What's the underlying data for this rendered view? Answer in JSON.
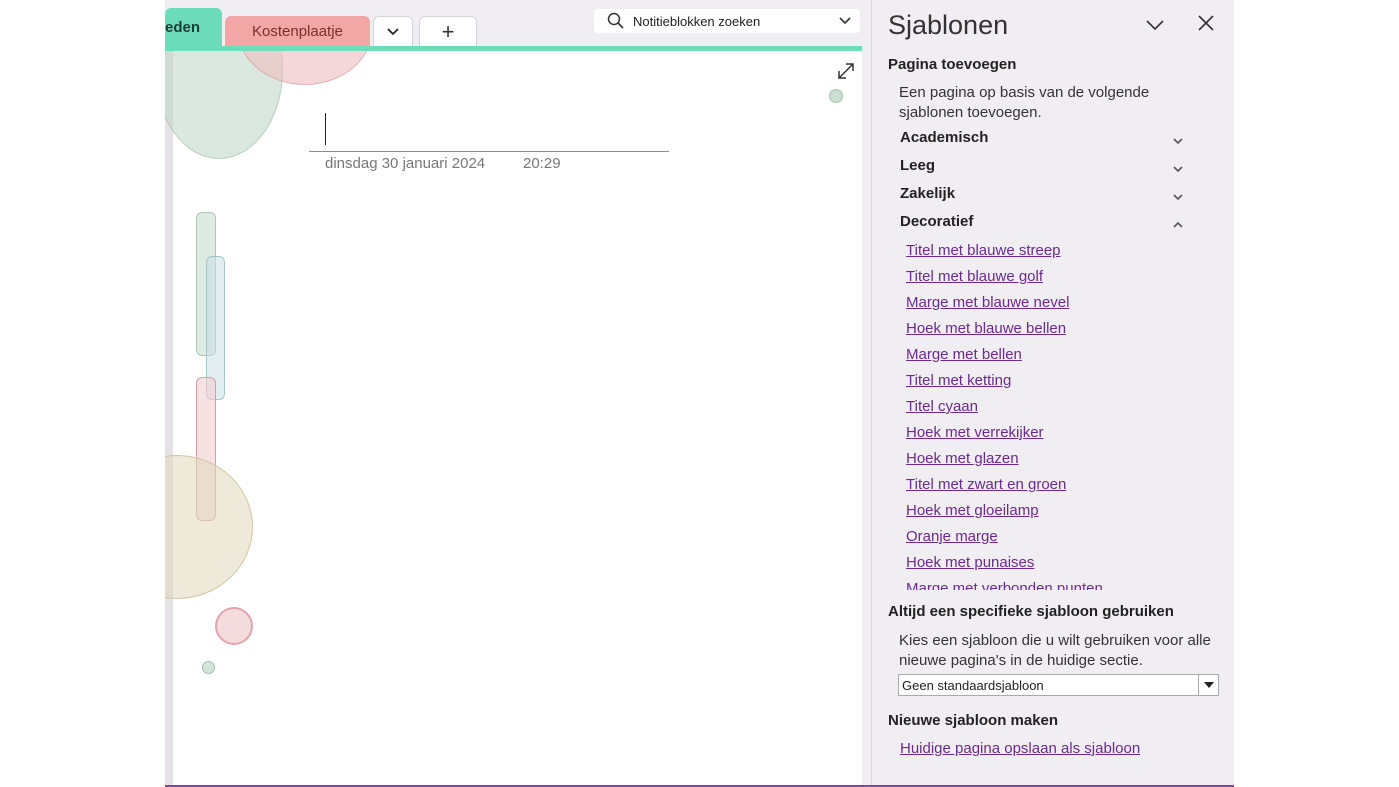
{
  "tabs": {
    "active_label": "eden",
    "second_label": "Kostenplaatje",
    "add_label": "+"
  },
  "search": {
    "placeholder": "Notitieblokken zoeken"
  },
  "page": {
    "date": "dinsdag 30 januari 2024",
    "time": "20:29"
  },
  "panel": {
    "title": "Sjablonen",
    "add_page_heading": "Pagina toevoegen",
    "add_page_desc": "Een pagina op basis van de volgende sjablonen toevoegen.",
    "categories": [
      "Academisch",
      "Leeg",
      "Zakelijk",
      "Decoratief"
    ],
    "decorative_templates": [
      "Titel met blauwe streep",
      "Titel met blauwe golf",
      "Marge met blauwe nevel",
      "Hoek met blauwe bellen",
      "Marge met bellen",
      "Titel met ketting",
      "Titel cyaan",
      "Hoek met verrekijker",
      "Hoek met glazen",
      "Titel met zwart en groen",
      "Hoek met gloeilamp",
      "Oranje marge",
      "Hoek met punaises",
      "Marge met verbonden punten"
    ],
    "always_heading": "Altijd een specifieke sjabloon gebruiken",
    "always_desc": "Kies een sjabloon die u wilt gebruiken voor alle nieuwe pagina's in de huidige sectie.",
    "default_template": "Geen standaardsjabloon",
    "new_heading": "Nieuwe sjabloon maken",
    "save_link": "Huidige pagina opslaan als sjabloon"
  },
  "colors": {
    "tab_active": "#6ddcba",
    "tab_second": "#f3a6a6",
    "link": "#6a2a8e",
    "accent_bottom": "#7b4a98"
  }
}
